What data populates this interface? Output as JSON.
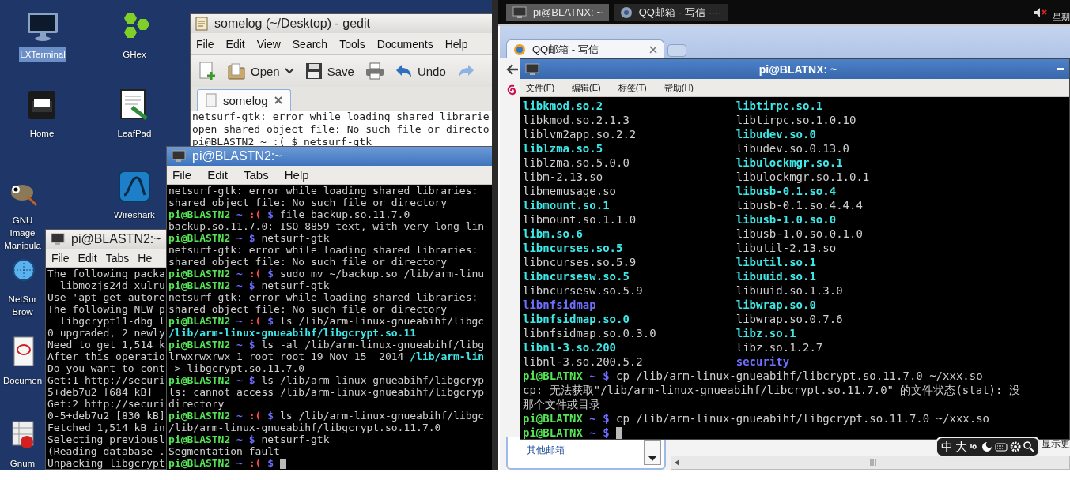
{
  "desktop": {
    "icons": [
      {
        "label": "LXTerminal",
        "kind": "monitor",
        "selected": true
      },
      {
        "label": "GHex",
        "kind": "hexagons",
        "selected": false
      },
      {
        "label": "Home",
        "kind": "drawer",
        "selected": false
      },
      {
        "label": "LeafPad",
        "kind": "notepad",
        "selected": false
      },
      {
        "label": "GNU Image Manipula",
        "kind": "mascot",
        "selected": false
      },
      {
        "label": "Wireshark",
        "kind": "fin",
        "selected": false
      },
      {
        "label": "NetSur Brow",
        "kind": "globe",
        "selected": false
      },
      {
        "label": "Documen",
        "kind": "document",
        "selected": false
      },
      {
        "label": "Gnum",
        "kind": "spreadsheet",
        "selected": false
      }
    ]
  },
  "editor": {
    "title": "somelog (~/Desktop) - gedit",
    "menu": [
      "File",
      "Edit",
      "View",
      "Search",
      "Tools",
      "Documents",
      "Help"
    ],
    "toolbar": [
      {
        "kind": "new"
      },
      {
        "kind": "open",
        "label": "Open"
      },
      {
        "kind": "save",
        "label": "Save"
      },
      {
        "kind": "print"
      },
      {
        "kind": "undo",
        "label": "Undo"
      },
      {
        "kind": "redo"
      }
    ],
    "tabs": [
      {
        "label": "somelog",
        "selected": true
      }
    ],
    "lines": [
      "netsurf-gtk: error while loading shared librarie",
      "open shared object file: No such file or directo",
      "pi@BLASTN2 ~ :( $ netsurf-gtk"
    ]
  },
  "back_terminal": {
    "title": "pi@BLASTN2:~",
    "menu": [
      "File",
      "Edit",
      "Tabs",
      "He"
    ],
    "lines": [
      "The following packa",
      "  libmozjs24d xulru",
      "Use 'apt-get autore",
      "The following NEW p",
      "  libgcrypt11-dbg l",
      "0 upgraded, 2 newly",
      "Need to get 1,514 k",
      "After this operatio",
      "Do you want to cont",
      "Get:1 http://securi",
      "5+deb7u2 [684 kB]",
      "Get:2 http://securi",
      "0-5+deb7u2 [830 kB]",
      "Fetched 1,514 kB in",
      "Selecting previousl",
      "(Reading database .",
      "Unpacking libgcrypt"
    ]
  },
  "front_terminal": {
    "title": "pi@BLASTN2:~",
    "menu": [
      "File",
      "Edit",
      "Tabs",
      "Help"
    ],
    "cursor": true,
    "lines": [
      [
        {
          "text": "netsurf-gtk: error while loading shared libraries:",
          "kind": "plain"
        }
      ],
      [
        {
          "text": "shared object file: No such file or directory",
          "kind": "plain"
        }
      ],
      [
        {
          "text": "pi@BLASTN2",
          "kind": "user"
        },
        {
          "text": " ~ ",
          "kind": "path"
        },
        {
          "text": ":(",
          "kind": "sad"
        },
        {
          "text": " $ ",
          "kind": "path"
        },
        {
          "text": "file backup.so.11.7.0",
          "kind": "plain"
        }
      ],
      [
        {
          "text": "backup.so.11.7.0: ISO-8859 text, with very long lin",
          "kind": "plain"
        }
      ],
      [
        {
          "text": "pi@BLASTN2",
          "kind": "user"
        },
        {
          "text": " ~ $ ",
          "kind": "path"
        },
        {
          "text": "netsurf-gtk",
          "kind": "plain"
        }
      ],
      [
        {
          "text": "netsurf-gtk: error while loading shared libraries:",
          "kind": "plain"
        }
      ],
      [
        {
          "text": "shared object file: No such file or directory",
          "kind": "plain"
        }
      ],
      [
        {
          "text": "pi@BLASTN2",
          "kind": "user"
        },
        {
          "text": " ~ ",
          "kind": "path"
        },
        {
          "text": ":(",
          "kind": "sad"
        },
        {
          "text": " $ ",
          "kind": "path"
        },
        {
          "text": "sudo mv ~/backup.so /lib/arm-linu",
          "kind": "plain"
        }
      ],
      [
        {
          "text": "pi@BLASTN2",
          "kind": "user"
        },
        {
          "text": " ~ $ ",
          "kind": "path"
        },
        {
          "text": "netsurf-gtk",
          "kind": "plain"
        }
      ],
      [
        {
          "text": "netsurf-gtk: error while loading shared libraries:",
          "kind": "plain"
        }
      ],
      [
        {
          "text": "shared object file: No such file or directory",
          "kind": "plain"
        }
      ],
      [
        {
          "text": "pi@BLASTN2",
          "kind": "user"
        },
        {
          "text": " ~ ",
          "kind": "path"
        },
        {
          "text": ":(",
          "kind": "sad"
        },
        {
          "text": " $ ",
          "kind": "path"
        },
        {
          "text": "ls /lib/arm-linux-gnueabihf/libgc",
          "kind": "plain"
        }
      ],
      [
        {
          "text": "/lib/arm-linux-gnueabihf/libgcrypt.so.11",
          "kind": "link"
        }
      ],
      [
        {
          "text": "pi@BLASTN2",
          "kind": "user"
        },
        {
          "text": " ~ $ ",
          "kind": "path"
        },
        {
          "text": "ls -al /lib/arm-linux-gnueabihf/libg",
          "kind": "plain"
        }
      ],
      [
        {
          "text": "lrwxrwxrwx 1 root root 19 Nov 15  2014 ",
          "kind": "plain"
        },
        {
          "text": "/lib/arm-lin",
          "kind": "link"
        }
      ],
      [
        {
          "text": "-> libgcrypt.so.11.7.0",
          "kind": "plain"
        }
      ],
      [
        {
          "text": "pi@BLASTN2",
          "kind": "user"
        },
        {
          "text": " ~ $ ",
          "kind": "path"
        },
        {
          "text": "ls /lib/arm-linux-gnueabihf/libgcryp",
          "kind": "plain"
        }
      ],
      [
        {
          "text": "ls: cannot access /lib/arm-linux-gnueabihf/libgcryp",
          "kind": "plain"
        }
      ],
      [
        {
          "text": "directory",
          "kind": "plain"
        }
      ],
      [
        {
          "text": "pi@BLASTN2",
          "kind": "user"
        },
        {
          "text": " ~ ",
          "kind": "path"
        },
        {
          "text": ":(",
          "kind": "sad"
        },
        {
          "text": " $ ",
          "kind": "path"
        },
        {
          "text": "ls /lib/arm-linux-gnueabihf/libgc",
          "kind": "plain"
        }
      ],
      [
        {
          "text": "/lib/arm-linux-gnueabihf/libgcrypt.so.11.7.0",
          "kind": "plain"
        }
      ],
      [
        {
          "text": "pi@BLASTN2",
          "kind": "user"
        },
        {
          "text": " ~ $ ",
          "kind": "path"
        },
        {
          "text": "netsurf-gtk",
          "kind": "plain"
        }
      ],
      [
        {
          "text": "Segmentation fault",
          "kind": "plain"
        }
      ],
      [
        {
          "text": "pi@BLASTN2",
          "kind": "user"
        },
        {
          "text": " ~ ",
          "kind": "path"
        },
        {
          "text": ":(",
          "kind": "sad"
        },
        {
          "text": " $ ",
          "kind": "path"
        }
      ]
    ]
  },
  "taskbar": {
    "items": [
      {
        "label": "pi@BLATNX: ~",
        "kind": "terminal",
        "selected": true
      },
      {
        "label": "QQ邮箱 - 写信 -···",
        "kind": "browser",
        "selected": false
      }
    ],
    "clock": "星期"
  },
  "browser": {
    "tabs": [
      {
        "label": "QQ邮箱 - 写信",
        "selected": true
      }
    ],
    "sidebar_link": "其他邮箱",
    "more_text": "显示更"
  },
  "mail_terminal": {
    "title": "pi@BLATNX: ~",
    "menu": [
      "文件(F)",
      "编辑(E)",
      "标签(T)",
      "帮助(H)"
    ],
    "cursor": true,
    "listing": [
      {
        "left": {
          "text": "libkmod.so.2",
          "kind": "link"
        },
        "right": {
          "text": "libtirpc.so.1",
          "kind": "link"
        }
      },
      {
        "left": {
          "text": "libkmod.so.2.1.3",
          "kind": "plain"
        },
        "right": {
          "text": "libtirpc.so.1.0.10",
          "kind": "plain"
        }
      },
      {
        "left": {
          "text": "liblvm2app.so.2.2",
          "kind": "plain"
        },
        "right": {
          "text": "libudev.so.0",
          "kind": "link"
        }
      },
      {
        "left": {
          "text": "liblzma.so.5",
          "kind": "link"
        },
        "right": {
          "text": "libudev.so.0.13.0",
          "kind": "plain"
        }
      },
      {
        "left": {
          "text": "liblzma.so.5.0.0",
          "kind": "plain"
        },
        "right": {
          "text": "libulockmgr.so.1",
          "kind": "link"
        }
      },
      {
        "left": {
          "text": "libm-2.13.so",
          "kind": "plain"
        },
        "right": {
          "text": "libulockmgr.so.1.0.1",
          "kind": "plain"
        }
      },
      {
        "left": {
          "text": "libmemusage.so",
          "kind": "plain"
        },
        "right": {
          "text": "libusb-0.1.so.4",
          "kind": "link"
        }
      },
      {
        "left": {
          "text": "libmount.so.1",
          "kind": "link"
        },
        "right": {
          "text": "libusb-0.1.so.4.4.4",
          "kind": "plain"
        }
      },
      {
        "left": {
          "text": "libmount.so.1.1.0",
          "kind": "plain"
        },
        "right": {
          "text": "libusb-1.0.so.0",
          "kind": "link"
        }
      },
      {
        "left": {
          "text": "libm.so.6",
          "kind": "link"
        },
        "right": {
          "text": "libusb-1.0.so.0.1.0",
          "kind": "plain"
        }
      },
      {
        "left": {
          "text": "libncurses.so.5",
          "kind": "link"
        },
        "right": {
          "text": "libutil-2.13.so",
          "kind": "plain"
        }
      },
      {
        "left": {
          "text": "libncurses.so.5.9",
          "kind": "plain"
        },
        "right": {
          "text": "libutil.so.1",
          "kind": "link"
        }
      },
      {
        "left": {
          "text": "libncursesw.so.5",
          "kind": "link"
        },
        "right": {
          "text": "libuuid.so.1",
          "kind": "link"
        }
      },
      {
        "left": {
          "text": "libncursesw.so.5.9",
          "kind": "plain"
        },
        "right": {
          "text": "libuuid.so.1.3.0",
          "kind": "plain"
        }
      },
      {
        "left": {
          "text": "libnfsidmap",
          "kind": "dir"
        },
        "right": {
          "text": "libwrap.so.0",
          "kind": "link"
        }
      },
      {
        "left": {
          "text": "libnfsidmap.so.0",
          "kind": "link"
        },
        "right": {
          "text": "libwrap.so.0.7.6",
          "kind": "plain"
        }
      },
      {
        "left": {
          "text": "libnfsidmap.so.0.3.0",
          "kind": "plain"
        },
        "right": {
          "text": "libz.so.1",
          "kind": "link"
        }
      },
      {
        "left": {
          "text": "libnl-3.so.200",
          "kind": "link"
        },
        "right": {
          "text": "libz.so.1.2.7",
          "kind": "plain"
        }
      },
      {
        "left": {
          "text": "libnl-3.so.200.5.2",
          "kind": "plain"
        },
        "right": {
          "text": "security",
          "kind": "dir"
        }
      }
    ],
    "lines": [
      [
        {
          "text": "pi@BLATNX",
          "kind": "user"
        },
        {
          "text": " ~ $ ",
          "kind": "path"
        },
        {
          "text": "cp /lib/arm-linux-gnueabihf/libcrypt.so.11.7.0 ~/xxx.so",
          "kind": "plain"
        }
      ],
      [
        {
          "text": "cp: 无法获取\"/lib/arm-linux-gnueabihf/libcrypt.so.11.7.0\" 的文件状态(stat): 没",
          "kind": "plain"
        }
      ],
      [
        {
          "text": "那个文件或目录",
          "kind": "plain"
        }
      ],
      [
        {
          "text": "pi@BLATNX",
          "kind": "user"
        },
        {
          "text": " ~ $ ",
          "kind": "path"
        },
        {
          "text": "cp /lib/arm-linux-gnueabihf/libgcrypt.so.11.7.0 ~/xxx.so",
          "kind": "plain"
        }
      ],
      [
        {
          "text": "pi@BLATNX",
          "kind": "user"
        },
        {
          "text": " ~ $ ",
          "kind": "path"
        }
      ]
    ]
  },
  "input_method": {
    "modes": [
      "中",
      "大"
    ]
  }
}
